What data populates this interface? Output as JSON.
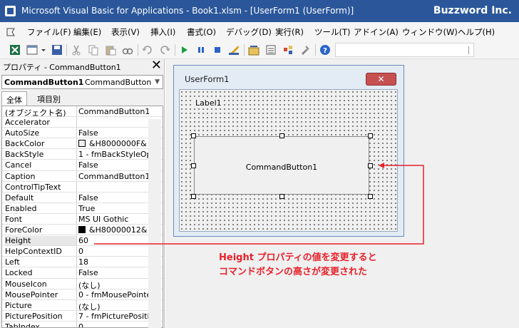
{
  "window": {
    "title": "Microsoft Visual Basic for Applications - Book1.xlsm - [UserForm1 (UserForm)]",
    "brand": "Buzzword Inc."
  },
  "menu": [
    "ファイル(F)",
    "編集(E)",
    "表示(V)",
    "挿入(I)",
    "書式(O)",
    "デバッグ(D)",
    "実行(R)",
    "ツール(T)",
    "アドイン(A)",
    "ウィンドウ(W)",
    "ヘルプ(H)"
  ],
  "properties": {
    "header": "プロパティ - CommandButton1",
    "object_name": "CommandButton1",
    "object_type": "CommandButton",
    "tabs": [
      "全体",
      "項目別"
    ],
    "rows": [
      {
        "name": "(オブジェクト名)",
        "value": "CommandButton1"
      },
      {
        "name": "Accelerator",
        "value": ""
      },
      {
        "name": "AutoSize",
        "value": "False"
      },
      {
        "name": "BackColor",
        "value": "&H8000000F&",
        "swatch": "#f0f0f0"
      },
      {
        "name": "BackStyle",
        "value": "1 - fmBackStyleOp"
      },
      {
        "name": "Cancel",
        "value": "False"
      },
      {
        "name": "Caption",
        "value": "CommandButton1"
      },
      {
        "name": "ControlTipText",
        "value": ""
      },
      {
        "name": "Default",
        "value": "False"
      },
      {
        "name": "Enabled",
        "value": "True"
      },
      {
        "name": "Font",
        "value": "MS UI Gothic"
      },
      {
        "name": "ForeColor",
        "value": "&H80000012&",
        "swatch": "#000000"
      },
      {
        "name": "Height",
        "value": "60"
      },
      {
        "name": "HelpContextID",
        "value": "0"
      },
      {
        "name": "Left",
        "value": "18"
      },
      {
        "name": "Locked",
        "value": "False"
      },
      {
        "name": "MouseIcon",
        "value": "(なし)"
      },
      {
        "name": "MousePointer",
        "value": "0 - fmMousePointe"
      },
      {
        "name": "Picture",
        "value": "(なし)"
      },
      {
        "name": "PicturePosition",
        "value": "7 - fmPicturePositi"
      },
      {
        "name": "TabIndex",
        "value": "0"
      }
    ]
  },
  "form": {
    "title": "UserForm1",
    "label": "Label1",
    "button": "CommandButton1"
  },
  "annotation": {
    "line1": "Height プロパティの値を変更すると",
    "line2": "コマンドボタンの高さが変更された",
    "color": "#e8202a"
  }
}
